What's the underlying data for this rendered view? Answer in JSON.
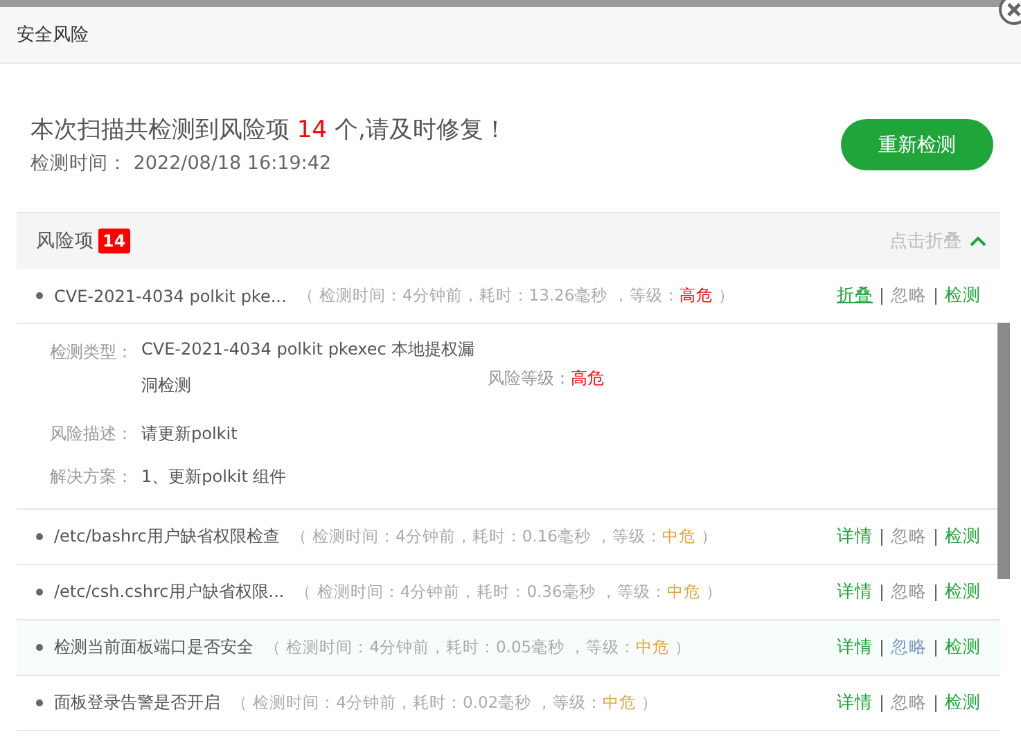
{
  "window": {
    "title": "安全风险"
  },
  "summary": {
    "prefix": "本次扫描共检测到风险项",
    "count": "14",
    "suffix": "个,请及时修复！",
    "time_label": "检测时间：",
    "time_value": "2022/08/18 16:19:42",
    "rescan_button": "重新检测"
  },
  "panel": {
    "title": "风险项",
    "count": "14",
    "collapse_link": "点击折叠",
    "expanded": true
  },
  "risks": [
    {
      "name": "CVE-2021-4034 polkit pke...",
      "meta": "（ 检测时间：4分钟前，耗时：13.26毫秒 ，等级：",
      "level": "高危",
      "meta_end": "）",
      "color": "#ff0000",
      "hovered": false,
      "expanded": true,
      "actions": [
        "折叠",
        "忽略",
        "检测"
      ],
      "details": {
        "type_label": "检测类型：",
        "type_value": "CVE-2021-4034 polkit pkexec 本地提权漏洞检测",
        "level_label": "风险等级：",
        "level_value": "高危",
        "desc_label": "风险描述：",
        "desc_value": "请更新polkit",
        "solution_label": "解决方案：",
        "solution_value": "1、更新polkit 组件"
      }
    },
    {
      "name": "/etc/bashrc用户缺省权限检查",
      "meta": "（ 检测时间：4分钟前，耗时：0.16毫秒 ，等级：",
      "level": "中危",
      "meta_end": "）",
      "color": "#e6a23c",
      "hovered": false,
      "expanded": false,
      "actions": [
        "详情",
        "忽略",
        "检测"
      ]
    },
    {
      "name": "/etc/csh.cshrc用户缺省权限...",
      "meta": "（ 检测时间：4分钟前，耗时：0.36毫秒 ，等级：",
      "level": "中危",
      "meta_end": "）",
      "color": "#e6a23c",
      "hovered": false,
      "expanded": false,
      "actions": [
        "详情",
        "忽略",
        "检测"
      ]
    },
    {
      "name": "检测当前面板端口是否安全",
      "meta": "（ 检测时间：4分钟前，耗时：0.05毫秒 ，等级：",
      "level": "中危",
      "meta_end": "）",
      "color": "#e6a23c",
      "hovered": true,
      "expanded": false,
      "actions": [
        "详情",
        "忽略",
        "检测"
      ]
    },
    {
      "name": "面板登录告警是否开启",
      "meta": "（ 检测时间：4分钟前，耗时：0.02毫秒 ，等级：",
      "level": "中危",
      "meta_end": "）",
      "color": "#e6a23c",
      "hovered": false,
      "expanded": false,
      "actions": [
        "详情",
        "忽略",
        "检测"
      ]
    }
  ]
}
